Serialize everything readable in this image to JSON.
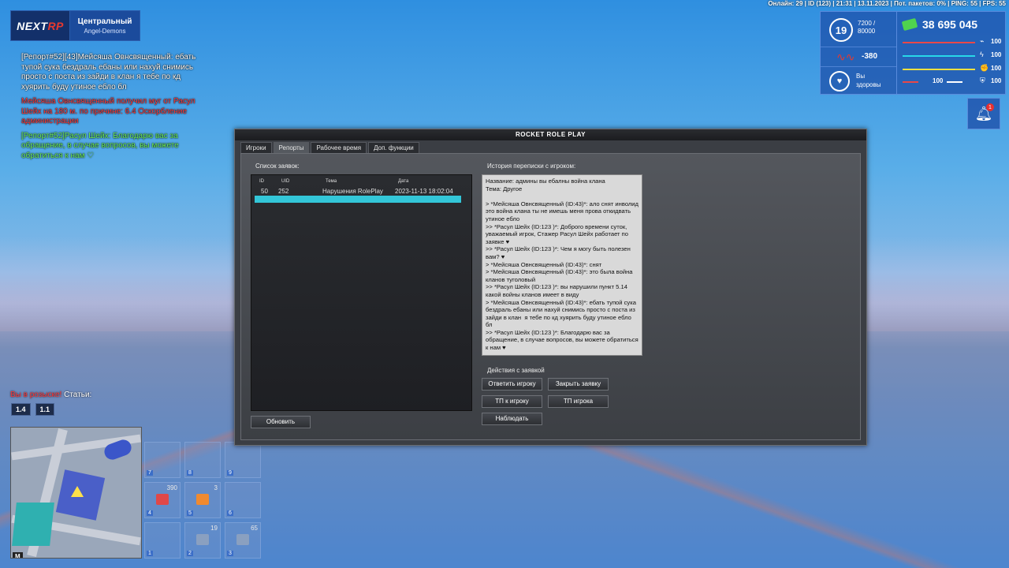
{
  "statusbar": {
    "text": "Онлайн: 29 | ID (123) | 21:31 | 13.11.2023 | Пот. пакетов: 0% | PING: 55 | FPS: 55"
  },
  "server": {
    "logo_main": "NEXT",
    "logo_accent": "RP",
    "name": "Центральный",
    "family": "Angel-Demons"
  },
  "chat": [
    {
      "color": "white",
      "text": "[Репорт#52][43]Мейсяша Овнсвященный: ебать тупой сука бездраль ебаны или нахуй снимись просто с поста из зайди в клан я тебе по кд хуярить буду утиное ебло бл"
    },
    {
      "color": "red",
      "text": "Мейсяша Овнсвященный получил муг от Расул Шейх на 180 м. по причине: 6.4 Оскорбление администрации"
    },
    {
      "color": "green",
      "text": "[Репорт#52]Расул Шейх: Благодарю вас за обращение, в случае вопросов, вы можете обратиться к нам ♡"
    }
  ],
  "wanted": {
    "prefix": "Вы в розыске!",
    "suffix": " Статьи:",
    "articles": [
      "1.4",
      "1.1"
    ]
  },
  "minimap": {
    "key": "M"
  },
  "slots": [
    {
      "num": "7",
      "count": "",
      "icon": ""
    },
    {
      "num": "8",
      "count": "",
      "icon": ""
    },
    {
      "num": "9",
      "count": "",
      "icon": ""
    },
    {
      "num": "4",
      "count": "390",
      "icon": "medkit-icon",
      "color": "#e04848"
    },
    {
      "num": "5",
      "count": "3",
      "icon": "jerrycan-icon",
      "color": "#f08a30"
    },
    {
      "num": "6",
      "count": "",
      "icon": ""
    },
    {
      "num": "1",
      "count": "",
      "icon": ""
    },
    {
      "num": "2",
      "count": "19",
      "icon": "pistol-icon",
      "color": "#8aa0c0"
    },
    {
      "num": "3",
      "count": "65",
      "icon": "rifle-icon",
      "color": "#8aa0c0"
    }
  ],
  "hud": {
    "level": "19",
    "exp_current": "7200 /",
    "exp_total": "80000",
    "wave_value": "-380",
    "health_status_line1": "Вы",
    "health_status_line2": "здоровы",
    "money": "38 695 045",
    "bars": [
      {
        "name": "health",
        "value": "100",
        "color": "#e84848",
        "icon": "pulse-icon",
        "level": 1.0
      },
      {
        "name": "hunger",
        "value": "100",
        "color": "#28d8e8",
        "icon": "bolt-icon",
        "level": 1.0
      },
      {
        "name": "stamina",
        "value": "100",
        "color": "#f0e040",
        "icon": "arm-icon",
        "level": 1.0
      }
    ],
    "bottom": {
      "left_value": "100",
      "right_value": "100",
      "left_color": "#e84848",
      "right_color": "#ffffff"
    }
  },
  "notifications": {
    "badge": "1"
  },
  "dialog": {
    "title": "ROCKET ROLE PLAY",
    "tabs": [
      "Игроки",
      "Репорты",
      "Рабочее время",
      "Доп. функции"
    ],
    "active_tab": 1,
    "list_label": "Список заявок:",
    "columns": [
      "ID",
      "UID",
      "Тема",
      "Дата"
    ],
    "rows": [
      {
        "id": "50",
        "uid": "252",
        "topic": "Нарушения RolePlay",
        "date": "2023-11-13 18:02:04",
        "selected": false
      },
      {
        "id": "",
        "uid": "",
        "topic": "",
        "date": "",
        "selected": true
      }
    ],
    "refresh_label": "Обновить",
    "history_label": "История переписки с игроком:",
    "history_text": "Название: админы вы ебалны война клана\nТема: Другое\n\n> *Мейсяша Овнсвященный (ID:43)*: ало снят инволид это война клана ты не имешь меня прова откидвать утиное ебло\n>> *Расул Шейх (ID:123 )*: Доброго времени суток, уважаемый игрок, Стажер Расул Шейх работает по заявке ♥\n>> *Расул Шейх (ID:123 )*: Чем я могу быть полезен вам? ♥\n> *Мейсяша Овнсвященный (ID:43)*: снят\n> *Мейсяша Овнсвященный (ID:43)*: это была война кланов туголовый\n>> *Расул Шейх (ID:123 )*: вы нарушили пункт 5.14 какой войны кланов имеет в виду\n> *Мейсяша Овнсвященный (ID:43)*: ебать тупой сука бездраль ебаны или нахуй снимись просто с поста из зайди в клан  я тебе по кд хуярить буду утиное ебло бл\n>> *Расул Шейх (ID:123 )*: Благодарю вас за обращение, в случае вопросов, вы можете обратиться к нам ♥",
    "actions_label": "Действия с заявкой",
    "buttons": {
      "reply": "Ответить игроку",
      "close": "Закрыть заявку",
      "tp_to": "ТП к игроку",
      "tp_here": "ТП игрока",
      "spectate": "Наблюдать"
    }
  }
}
